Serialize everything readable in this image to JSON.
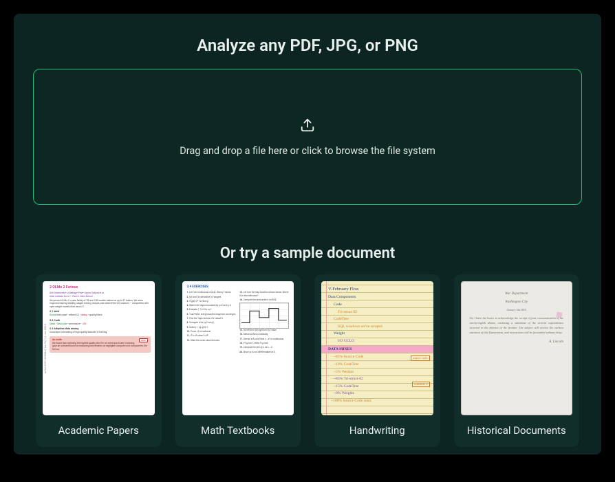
{
  "title": "Analyze any PDF, JPG, or PNG",
  "dropzone": {
    "icon": "upload-icon",
    "text": "Drag and drop a file here or click to browse the file system"
  },
  "samples_heading": "Or try a sample document",
  "samples": [
    {
      "label": "Academic Papers"
    },
    {
      "label": "Math Textbooks"
    },
    {
      "label": "Handwriting"
    },
    {
      "label": "Historical Documents"
    }
  ],
  "thumbnails": {
    "academic": {
      "section_title": "2 OLMo 2 Furious",
      "subheads": [
        "2.1  Web",
        "2.2  Code",
        "2.3  Adaptive data mixing"
      ],
      "callout_tag": "OMG",
      "callout_head": "An aside"
    },
    "math": {
      "heading": "3.4  EXERCISES"
    },
    "handwriting": {
      "title_line": "V-February Flow",
      "lines": [
        "Data Components",
        "Code",
        "Tri-struct 02",
        "CodeTree",
        "SQL windows we've scraped",
        "Weight",
        "I/O GCLO"
      ],
      "section": "DATA MIXES",
      "mixes": [
        "~85%  Source Code",
        "~10%  CodeTree",
        "~5%   Weldon"
      ],
      "side_tag_1": "source\ncode",
      "mixes2": [
        "~85%  Tri-struct-02",
        "~15%  CodeTree",
        "~0%   Weights"
      ],
      "side_tag_2": "schedule\n2",
      "last": "~100%  Source Code   sonic"
    },
    "historical": {
      "header": "War Department",
      "place": "Washington City",
      "date": "January 5th 1815"
    }
  }
}
